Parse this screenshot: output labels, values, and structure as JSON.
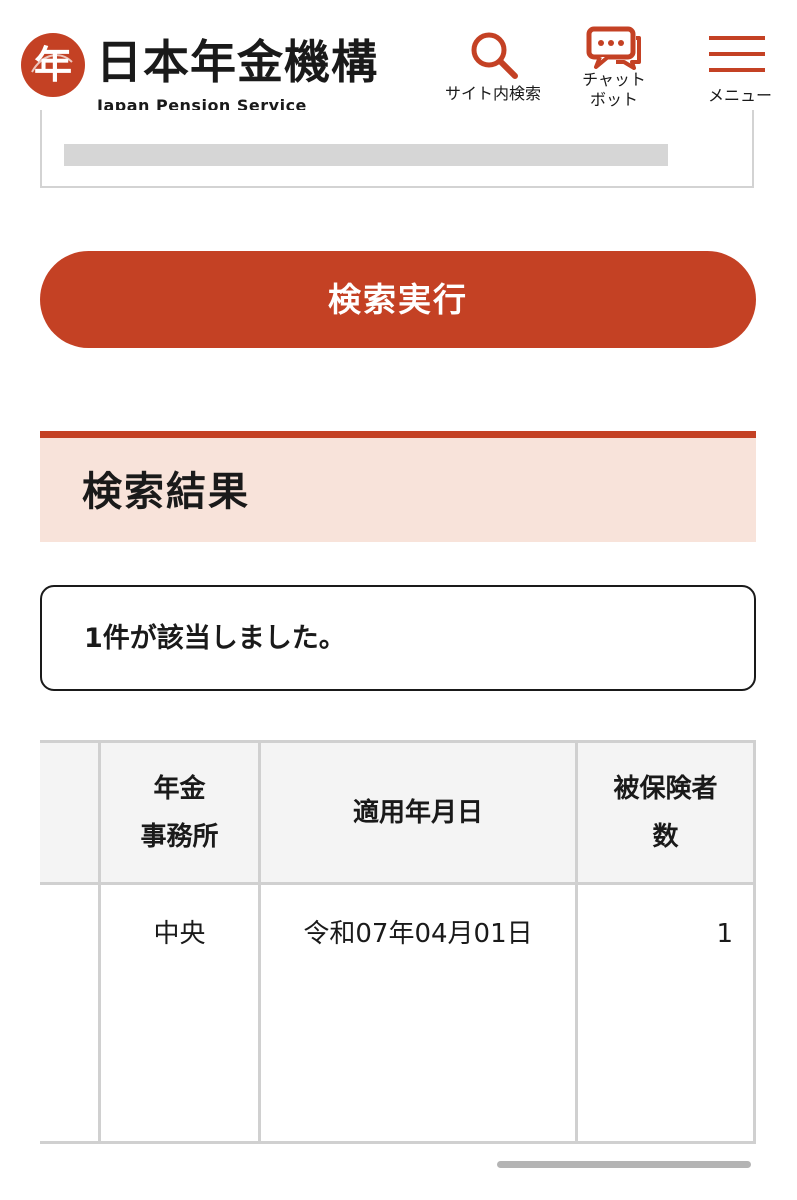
{
  "header": {
    "logo_title": "日本年金機構",
    "logo_subtitle": "Japan Pension Service",
    "logo_seal_char": "年",
    "search_label": "サイト内検索",
    "chat_label_line1": "チャット",
    "chat_label_line2": "ボット",
    "menu_label": "メニュー"
  },
  "search": {
    "button_label": "検索実行"
  },
  "results": {
    "heading": "検索結果",
    "count_text": "1件が該当しました。",
    "columns": [
      {
        "line1": "年金",
        "line2": "事務所"
      },
      {
        "line1": "適用年月日",
        "line2": ""
      },
      {
        "line1": "被保険者",
        "line2": "数"
      }
    ],
    "rows": [
      {
        "office": "中央",
        "date": "令和07年04月01日",
        "count": "1"
      }
    ]
  },
  "colors": {
    "accent": "#c44124",
    "heading_bg": "#f8e3da",
    "table_header_bg": "#f4f4f4",
    "border": "#d0d0d0"
  }
}
